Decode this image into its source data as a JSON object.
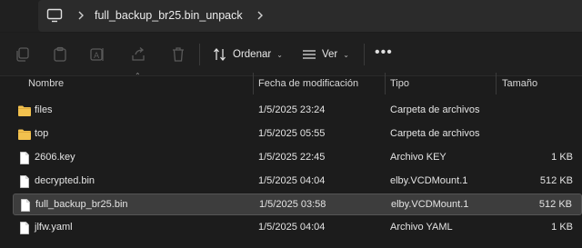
{
  "address": {
    "crumb": "full_backup_br25.bin_unpack"
  },
  "toolbar": {
    "sort_label": "Ordenar",
    "view_label": "Ver",
    "more_label": "•••"
  },
  "columns": {
    "name": "Nombre",
    "date": "Fecha de modificación",
    "type": "Tipo",
    "size": "Tamaño"
  },
  "files": [
    {
      "name": "files",
      "date": "1/5/2025 23:24",
      "type": "Carpeta de archivos",
      "size": "",
      "icon": "folder-icon"
    },
    {
      "name": "top",
      "date": "1/5/2025 05:55",
      "type": "Carpeta de archivos",
      "size": "",
      "icon": "folder-icon"
    },
    {
      "name": "2606.key",
      "date": "1/5/2025 22:45",
      "type": "Archivo KEY",
      "size": "1 KB",
      "icon": "file-icon"
    },
    {
      "name": "decrypted.bin",
      "date": "1/5/2025 04:04",
      "type": "elby.VCDMount.1",
      "size": "512 KB",
      "icon": "file-icon"
    },
    {
      "name": "full_backup_br25.bin",
      "date": "1/5/2025 03:58",
      "type": "elby.VCDMount.1",
      "size": "512 KB",
      "icon": "file-icon",
      "selected": true
    },
    {
      "name": "jlfw.yaml",
      "date": "1/5/2025 04:04",
      "type": "Archivo YAML",
      "size": "1 KB",
      "icon": "file-icon"
    }
  ],
  "colors": {
    "background": "#1c1c1c",
    "folder": "#f2c14e",
    "selected_row": "#3d3d3d"
  }
}
